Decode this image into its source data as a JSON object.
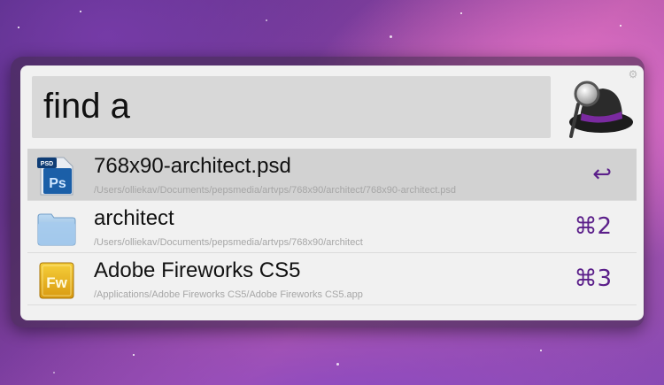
{
  "search": {
    "query": "find a"
  },
  "results": [
    {
      "title": "768x90-architect.psd",
      "path": "/Users/olliekav/Documents/pepsmedia/artvps/768x90/architect/768x90-architect.psd",
      "shortcut": "↩",
      "icon": "photoshop-file-icon",
      "icon_label_top": "PSD",
      "icon_label": "Ps"
    },
    {
      "title": "architect",
      "path": "/Users/olliekav/Documents/pepsmedia/artvps/768x90/architect",
      "shortcut": "⌘2",
      "icon": "folder-icon"
    },
    {
      "title": "Adobe Fireworks CS5",
      "path": "/Applications/Adobe Fireworks CS5/Adobe Fireworks CS5.app",
      "shortcut": "⌘3",
      "icon": "fireworks-app-icon",
      "icon_label": "Fw"
    }
  ],
  "colors": {
    "shortcut": "#5b1f8a",
    "panel": "#f1f1f1",
    "selected_row": "#d2d2d2"
  }
}
